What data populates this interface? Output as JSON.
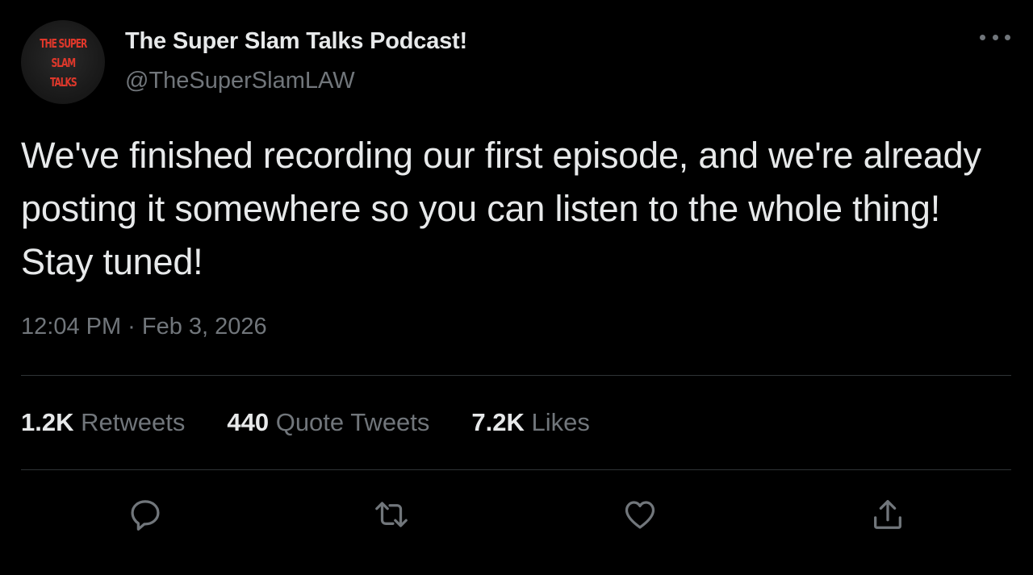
{
  "author": {
    "avatar_text": "THE SUPER\nSLAM\nTALKS",
    "display_name": "The Super Slam Talks Podcast!",
    "handle": "@TheSuperSlamLAW"
  },
  "tweet": {
    "text": "We've finished recording our first episode, and we're already posting it somewhere so you can listen to the whole thing! Stay tuned!",
    "timestamp": "12:04 PM · Feb 3, 2026"
  },
  "stats": {
    "retweets_count": "1.2K",
    "retweets_label": "Retweets",
    "quotes_count": "440",
    "quotes_label": "Quote Tweets",
    "likes_count": "7.2K",
    "likes_label": "Likes"
  },
  "actions": {
    "reply_icon": "reply-icon",
    "retweet_icon": "retweet-icon",
    "like_icon": "heart-icon",
    "share_icon": "share-icon"
  },
  "colors": {
    "background": "#000000",
    "primary_text": "#e7e9ea",
    "secondary_text": "#71767b",
    "divider": "#2f3336",
    "avatar_text": "#e0382b"
  }
}
